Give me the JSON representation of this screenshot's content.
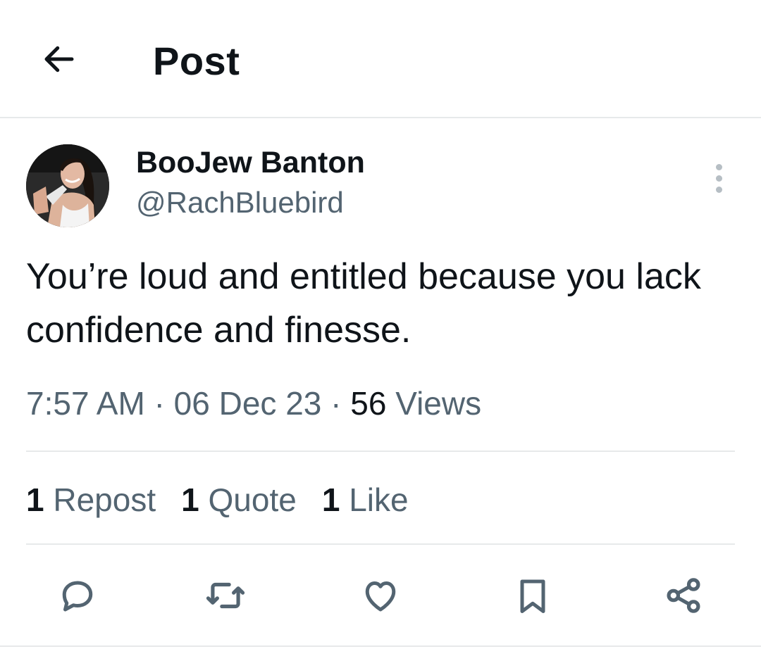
{
  "header": {
    "title": "Post",
    "back_icon": "arrow-left-icon"
  },
  "author": {
    "display_name": "BooJew Banton",
    "handle": "@RachBluebird"
  },
  "post": {
    "text": "You’re loud and entitled because you lack confidence and finesse.",
    "time": "7:57 AM",
    "separator": "·",
    "date": "06 Dec 23",
    "views_count": "56",
    "views_label": "Views"
  },
  "stats": [
    {
      "count": "1",
      "label": "Repost"
    },
    {
      "count": "1",
      "label": "Quote"
    },
    {
      "count": "1",
      "label": "Like"
    }
  ],
  "actions": [
    "reply-icon",
    "repost-icon",
    "like-icon",
    "bookmark-icon",
    "share-icon"
  ],
  "colors": {
    "text": "#0f1419",
    "secondary": "#536471",
    "divider": "#e7e9ea"
  }
}
